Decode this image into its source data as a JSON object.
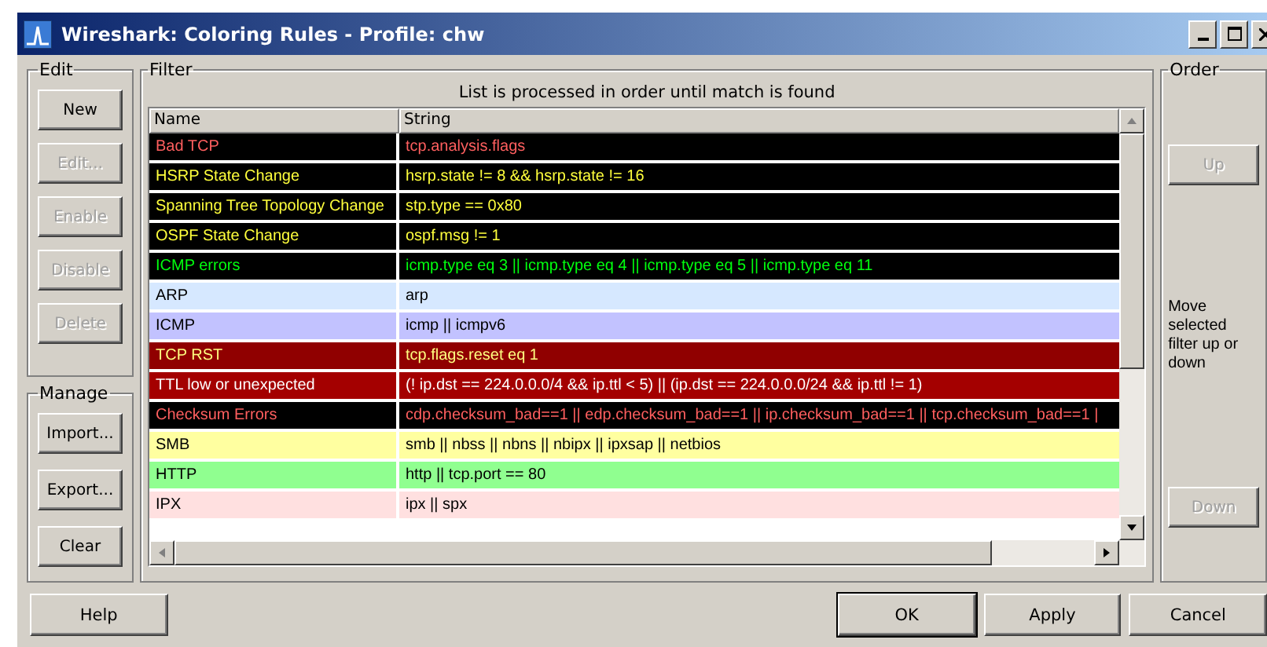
{
  "window": {
    "title": "Wireshark: Coloring Rules - Profile: chw"
  },
  "edit_group": {
    "title": "Edit",
    "buttons": [
      {
        "label": "New",
        "disabled": false
      },
      {
        "label": "Edit...",
        "disabled": true
      },
      {
        "label": "Enable",
        "disabled": true
      },
      {
        "label": "Disable",
        "disabled": true
      },
      {
        "label": "Delete",
        "disabled": true
      }
    ]
  },
  "manage_group": {
    "title": "Manage",
    "buttons": [
      {
        "label": "Import...",
        "disabled": false
      },
      {
        "label": "Export...",
        "disabled": false
      },
      {
        "label": "Clear",
        "disabled": false
      }
    ]
  },
  "filter_group": {
    "title": "Filter",
    "caption": "List is processed in order until match is found",
    "table": {
      "columns": [
        "Name",
        "String"
      ],
      "rows": [
        {
          "name": "Bad TCP",
          "string": "tcp.analysis.flags",
          "background": {
            "color": "#000000"
          },
          "foreground": {
            "color": "#ff5f5f"
          }
        },
        {
          "name": "HSRP State Change",
          "string": "hsrp.state != 8 && hsrp.state != 16",
          "background": {
            "color": "#000000"
          },
          "foreground": {
            "color": "#ffff3c"
          }
        },
        {
          "name": "Spanning Tree Topology  Change",
          "string": "stp.type == 0x80",
          "background": {
            "color": "#000000"
          },
          "foreground": {
            "color": "#ffff3c"
          }
        },
        {
          "name": "OSPF State Change",
          "string": "ospf.msg != 1",
          "background": {
            "color": "#000000"
          },
          "foreground": {
            "color": "#ffff3c"
          }
        },
        {
          "name": "ICMP errors",
          "string": "icmp.type eq 3 || icmp.type eq 4 || icmp.type eq 5 || icmp.type eq 11",
          "background": {
            "color": "#000000"
          },
          "foreground": {
            "color": "#00ff0e"
          }
        },
        {
          "name": "ARP",
          "string": "arp",
          "background": {
            "color": "#d6e8ff"
          },
          "foreground": {
            "color": "#000000"
          }
        },
        {
          "name": "ICMP",
          "string": "icmp || icmpv6",
          "background": {
            "color": "#c2c2ff"
          },
          "foreground": {
            "color": "#000000"
          }
        },
        {
          "name": "TCP RST",
          "string": "tcp.flags.reset eq 1",
          "background": {
            "color": "#900000"
          },
          "foreground": {
            "color": "#ffff80"
          }
        },
        {
          "name": "TTL low or unexpected",
          "string": "(! ip.dst == 224.0.0.0/4 && ip.ttl < 5) || (ip.dst == 224.0.0.0/24 && ip.ttl != 1)",
          "background": {
            "color": "#a40000"
          },
          "foreground": {
            "color": "#ffffff"
          }
        },
        {
          "name": "Checksum Errors",
          "string": "cdp.checksum_bad==1 || edp.checksum_bad==1 || ip.checksum_bad==1 || tcp.checksum_bad==1 |",
          "background": {
            "color": "#000000"
          },
          "foreground": {
            "color": "#ff5f5f"
          }
        },
        {
          "name": "SMB",
          "string": "smb || nbss || nbns || nbipx || ipxsap || netbios",
          "background": {
            "color": "#ffffa0"
          },
          "foreground": {
            "color": "#000000"
          }
        },
        {
          "name": "HTTP",
          "string": "http || tcp.port == 80",
          "background": {
            "color": "#90ff90"
          },
          "foreground": {
            "color": "#000000"
          }
        },
        {
          "name": "IPX",
          "string": "ipx || spx",
          "background": {
            "color": "#ffe0e0"
          },
          "foreground": {
            "color": "#000000"
          }
        }
      ]
    }
  },
  "order_group": {
    "title": "Order",
    "up": {
      "label": "Up",
      "disabled": true
    },
    "hint": "Move selected filter up or down",
    "down": {
      "label": "Down",
      "disabled": true
    }
  },
  "footer_buttons": [
    {
      "label": "Help",
      "default": false
    },
    {
      "label": "OK",
      "default": true
    },
    {
      "label": "Apply",
      "default": false
    },
    {
      "label": "Cancel",
      "default": false
    }
  ]
}
